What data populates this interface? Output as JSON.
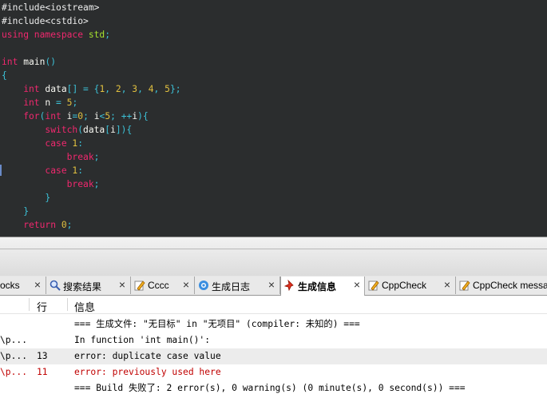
{
  "editor": {
    "lines": [
      [
        {
          "t": "#include<iostream>",
          "c": "tk-pre"
        }
      ],
      [
        {
          "t": "#include<cstdio>",
          "c": "tk-pre"
        }
      ],
      [
        {
          "t": "using namespace ",
          "c": "tk-kw"
        },
        {
          "t": "std",
          "c": "tk-lib"
        },
        {
          "t": ";",
          "c": "tk-op"
        }
      ],
      [],
      [
        {
          "t": "int ",
          "c": "tk-kw"
        },
        {
          "t": "main",
          "c": "tk-id"
        },
        {
          "t": "()",
          "c": "tk-op"
        }
      ],
      [
        {
          "t": "{",
          "c": "tk-op"
        }
      ],
      [
        {
          "t": "    int ",
          "c": "tk-kw"
        },
        {
          "t": "data",
          "c": "tk-id"
        },
        {
          "t": "[] = {",
          "c": "tk-op"
        },
        {
          "t": "1",
          "c": "tk-num"
        },
        {
          "t": ", ",
          "c": "tk-op"
        },
        {
          "t": "2",
          "c": "tk-num"
        },
        {
          "t": ", ",
          "c": "tk-op"
        },
        {
          "t": "3",
          "c": "tk-num"
        },
        {
          "t": ", ",
          "c": "tk-op"
        },
        {
          "t": "4",
          "c": "tk-num"
        },
        {
          "t": ", ",
          "c": "tk-op"
        },
        {
          "t": "5",
          "c": "tk-num"
        },
        {
          "t": "};",
          "c": "tk-op"
        }
      ],
      [
        {
          "t": "    int ",
          "c": "tk-kw"
        },
        {
          "t": "n",
          "c": "tk-id"
        },
        {
          "t": " = ",
          "c": "tk-op"
        },
        {
          "t": "5",
          "c": "tk-num"
        },
        {
          "t": ";",
          "c": "tk-op"
        }
      ],
      [
        {
          "t": "    for",
          "c": "tk-kw"
        },
        {
          "t": "(",
          "c": "tk-op"
        },
        {
          "t": "int ",
          "c": "tk-kw"
        },
        {
          "t": "i",
          "c": "tk-id"
        },
        {
          "t": "=",
          "c": "tk-op"
        },
        {
          "t": "0",
          "c": "tk-num"
        },
        {
          "t": "; ",
          "c": "tk-op"
        },
        {
          "t": "i",
          "c": "tk-id"
        },
        {
          "t": "<",
          "c": "tk-op"
        },
        {
          "t": "5",
          "c": "tk-num"
        },
        {
          "t": "; ++",
          "c": "tk-op"
        },
        {
          "t": "i",
          "c": "tk-id"
        },
        {
          "t": "){",
          "c": "tk-op"
        }
      ],
      [
        {
          "t": "        switch",
          "c": "tk-kw"
        },
        {
          "t": "(",
          "c": "tk-op"
        },
        {
          "t": "data",
          "c": "tk-id"
        },
        {
          "t": "[",
          "c": "tk-op"
        },
        {
          "t": "i",
          "c": "tk-id"
        },
        {
          "t": "]){",
          "c": "tk-op"
        }
      ],
      [
        {
          "t": "        case ",
          "c": "tk-kw"
        },
        {
          "t": "1",
          "c": "tk-num"
        },
        {
          "t": ":",
          "c": "tk-op"
        }
      ],
      [
        {
          "t": "            break",
          "c": "tk-kw"
        },
        {
          "t": ";",
          "c": "tk-op"
        }
      ],
      [
        {
          "t": "        case ",
          "c": "tk-kw"
        },
        {
          "t": "1",
          "c": "tk-num"
        },
        {
          "t": ":",
          "c": "tk-op"
        }
      ],
      [
        {
          "t": "            break",
          "c": "tk-kw"
        },
        {
          "t": ";",
          "c": "tk-op"
        }
      ],
      [
        {
          "t": "        }",
          "c": "tk-op"
        }
      ],
      [
        {
          "t": "    }",
          "c": "tk-op"
        }
      ],
      [
        {
          "t": "    return ",
          "c": "tk-kw"
        },
        {
          "t": "0",
          "c": "tk-num"
        },
        {
          "t": ";",
          "c": "tk-op"
        }
      ]
    ]
  },
  "tabs": [
    {
      "label": "ocks",
      "icon": "blocks-icon"
    },
    {
      "label": "搜索结果",
      "icon": "search-icon"
    },
    {
      "label": "Cccc",
      "icon": "pencil-icon"
    },
    {
      "label": "生成日志",
      "icon": "gear-icon"
    },
    {
      "label": "生成信息",
      "icon": "pushpin-icon",
      "active": true
    },
    {
      "label": "CppCheck",
      "icon": "pencil-icon"
    },
    {
      "label": "CppCheck messa",
      "icon": "pencil-icon"
    }
  ],
  "output": {
    "headers": {
      "file": "",
      "line": "行",
      "message": "信息"
    },
    "rows": [
      {
        "file": "",
        "line": "",
        "message": "=== 生成文件: \"无目标\" in \"无项目\" (compiler: 未知的) ===",
        "type": "info"
      },
      {
        "file": "\\p...",
        "line": "",
        "message": "In function 'int main()':",
        "type": "info"
      },
      {
        "file": "\\p...",
        "line": "13",
        "message": "error: duplicate case value",
        "type": "info"
      },
      {
        "file": "\\p...",
        "line": "11",
        "message": "error: previously used here",
        "type": "error"
      },
      {
        "file": "",
        "line": "",
        "message": "=== Build 失败了: 2 error(s), 0 warning(s) (0 minute(s), 0 second(s)) ===",
        "type": "info"
      }
    ]
  },
  "colors": {
    "editor_bg": "#2b2d2e",
    "keyword": "#f0286e",
    "number": "#e0c040",
    "operator": "#3cc2d8",
    "error_text": "#c00000"
  }
}
